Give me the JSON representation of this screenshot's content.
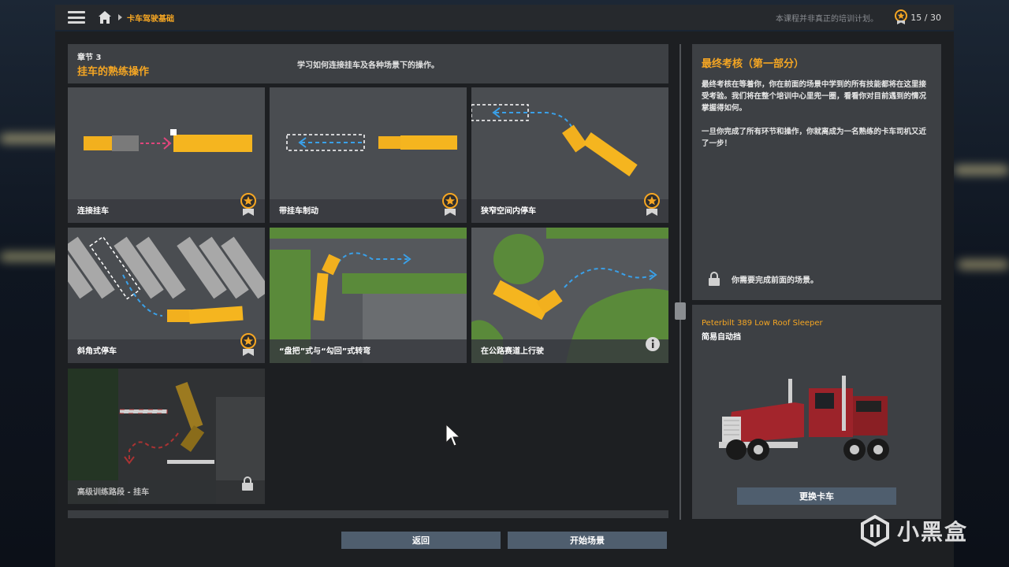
{
  "topbar": {
    "breadcrumb": "卡车驾驶基础",
    "note": "本课程并非真正的培训计划。",
    "progress": "15 / 30"
  },
  "chapter": {
    "number": "章节 3",
    "title": "挂车的熟练操作",
    "description": "学习如何连接挂车及各种场景下的操作。"
  },
  "scenarios": [
    {
      "label": "连接挂车",
      "status": "medal"
    },
    {
      "label": "带挂车制动",
      "status": "medal"
    },
    {
      "label": "狭窄空间内停车",
      "status": "medal"
    },
    {
      "label": "斜角式停车",
      "status": "medal"
    },
    {
      "label": "“盘把”式与“勾回”式转弯",
      "status": "none"
    },
    {
      "label": "在公路赛道上行驶",
      "status": "info"
    },
    {
      "label": "高级训练路段 - 挂车",
      "status": "locked"
    }
  ],
  "final_exam": {
    "title": "最终考核（第一部分）",
    "paragraph1": "最终考核在等着你，你在前面的场景中学到的所有技能都将在这里接受考验。我们将在整个培训中心里兜一圈，看看你对目前遇到的情况掌握得如何。",
    "paragraph2": "一旦你完成了所有环节和操作，你就离成为一名熟练的卡车司机又近了一步！",
    "lock_text": "你需要完成前面的场景。"
  },
  "truck": {
    "name": "Peterbilt 389 Low Roof Sleeper",
    "transmission": "简易自动挡",
    "change_label": "更换卡车"
  },
  "buttons": {
    "back": "返回",
    "start": "开始场景"
  },
  "watermark": "小黑盒",
  "colors": {
    "accent": "#f5a623",
    "button": "#4f5e6e",
    "panel": "#3d4044"
  }
}
